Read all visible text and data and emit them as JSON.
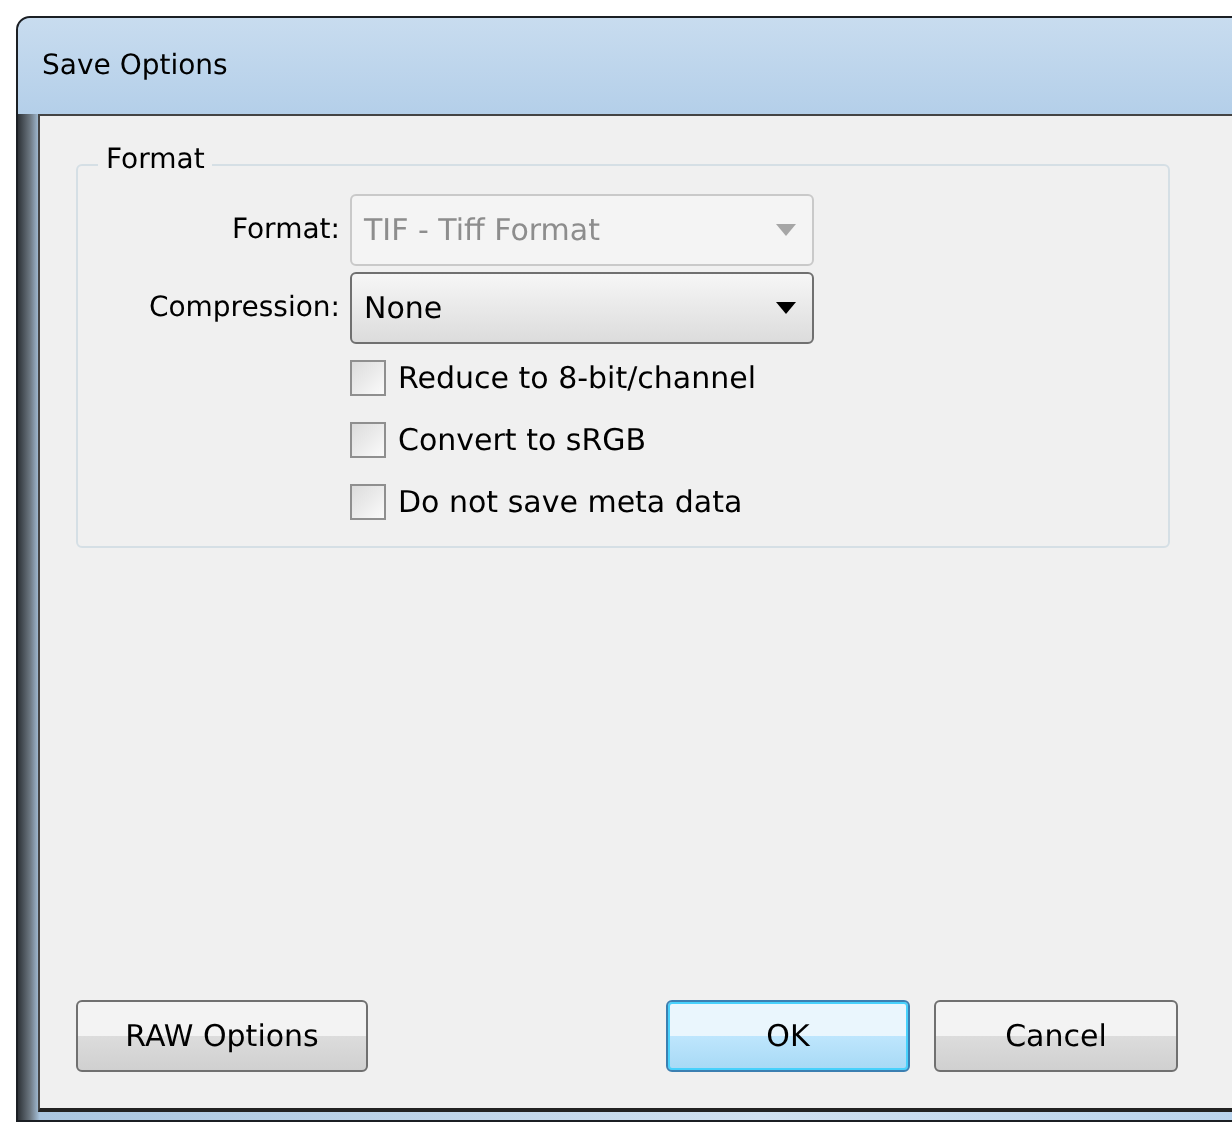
{
  "window": {
    "title": "Save Options"
  },
  "group": {
    "title": "Format",
    "fields": [
      {
        "label": "Format:",
        "value": "TIF - Tiff Format",
        "disabled": true
      },
      {
        "label": "Compression:",
        "value": "None",
        "disabled": false
      }
    ],
    "checkboxes": [
      {
        "label": "Reduce to 8-bit/channel",
        "checked": false
      },
      {
        "label": "Convert to sRGB",
        "checked": false
      },
      {
        "label": "Do not save meta data",
        "checked": false
      }
    ]
  },
  "left_button": {
    "label": "RAW Options",
    "default": false
  },
  "buttons": [
    {
      "label": "OK",
      "default": true
    },
    {
      "label": "Cancel",
      "default": false
    }
  ]
}
